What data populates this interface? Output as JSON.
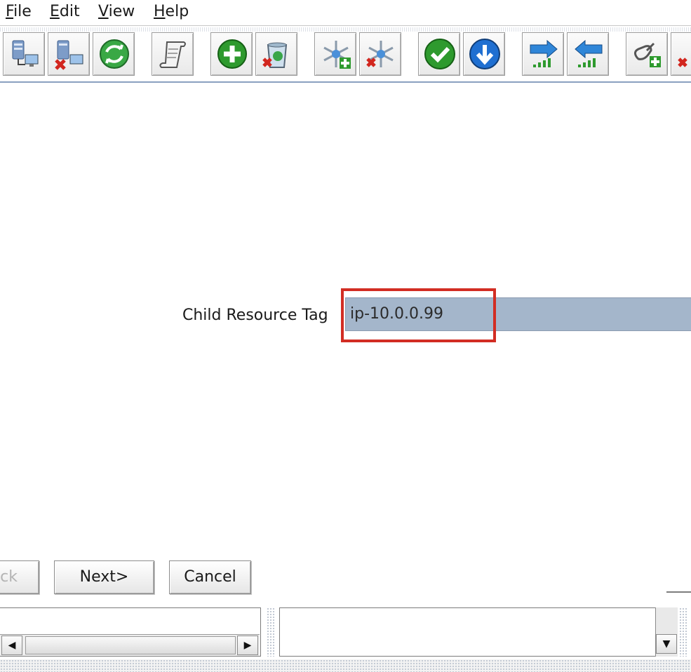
{
  "menu": {
    "file": {
      "mnemonic": "F",
      "rest": "ile"
    },
    "edit": {
      "mnemonic": "E",
      "rest": "dit"
    },
    "view": {
      "mnemonic": "V",
      "rest": "iew"
    },
    "help": {
      "mnemonic": "H",
      "rest": "elp"
    }
  },
  "toolbar": {
    "buttons": [
      {
        "icon": "connect-server-icon"
      },
      {
        "icon": "disconnect-server-icon"
      },
      {
        "icon": "refresh-icon"
      },
      {
        "icon": "script-scroll-icon"
      },
      {
        "icon": "add-icon"
      },
      {
        "icon": "delete-trash-icon"
      },
      {
        "icon": "add-resource-icon"
      },
      {
        "icon": "remove-resource-icon"
      },
      {
        "icon": "in-service-check-icon"
      },
      {
        "icon": "out-of-service-icon"
      },
      {
        "icon": "extend-right-icon"
      },
      {
        "icon": "unextend-left-icon"
      },
      {
        "icon": "create-dependency-icon"
      },
      {
        "icon": "delete-dependency-icon"
      }
    ]
  },
  "form": {
    "label": "Child Resource Tag",
    "value": "ip-10.0.0.99"
  },
  "buttons": {
    "back": "ck",
    "next": "Next>",
    "cancel": "Cancel"
  },
  "colors": {
    "highlight": "#d22d23",
    "input_bg": "#a4b6cb",
    "green": "#2e9a2e",
    "blue": "#1f6fd1"
  }
}
